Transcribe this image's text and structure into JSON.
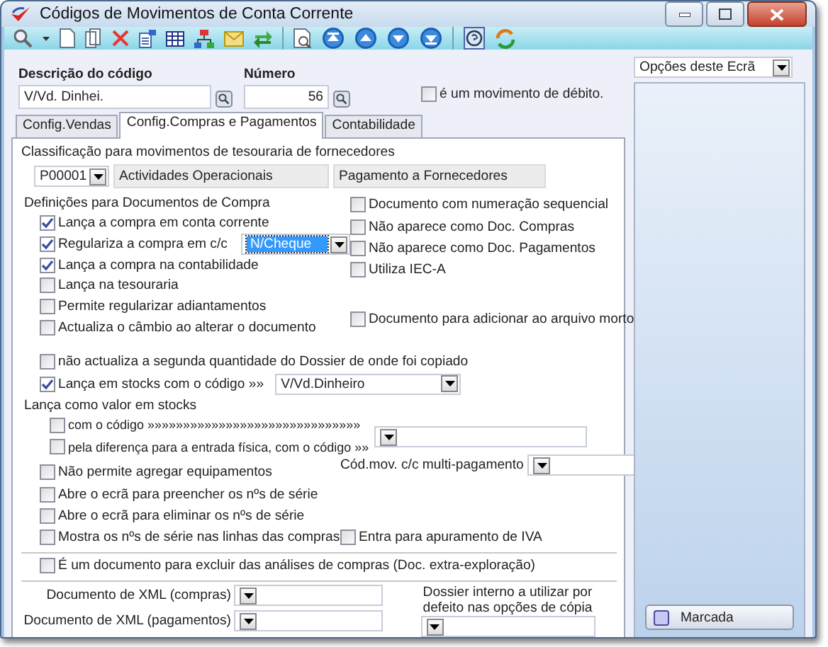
{
  "window": {
    "title": "Códigos de Movimentos de Conta Corrente"
  },
  "options_dropdown": {
    "value": "Opções deste Ecrã"
  },
  "description": {
    "label": "Descrição do código",
    "value": "V/Vd. Dinhei."
  },
  "number": {
    "label": "Número",
    "value": "56"
  },
  "debit": {
    "label": "é um movimento de débito.",
    "checked": false
  },
  "tabs": [
    {
      "label": "Config.Vendas",
      "selected": false
    },
    {
      "label": "Config.Compras e Pagamentos",
      "selected": true
    },
    {
      "label": "Contabilidade",
      "selected": false
    }
  ],
  "classification": {
    "label": "Classificação para movimentos de tesouraria de fornecedores",
    "code": "P00001",
    "category": "Actividades Operacionais",
    "description": "Pagamento a Fornecedores"
  },
  "purchase_definitions": {
    "title": "Definições para Documentos de Compra",
    "left": [
      {
        "kind": "checkbox",
        "label": "Lança a compra em conta corrente",
        "checked": true
      },
      {
        "kind": "checkbox_combo",
        "label": "Regulariza a compra em c/c",
        "checked": true,
        "value": "N/Cheque",
        "focused": true
      },
      {
        "kind": "checkbox",
        "label": "Lança a compra na contabilidade",
        "checked": true
      },
      {
        "kind": "checkbox",
        "label": "Lança na tesouraria",
        "checked": false
      },
      {
        "kind": "checkbox",
        "label": "Permite regularizar adiantamentos",
        "checked": false
      },
      {
        "kind": "checkbox",
        "label": "Actualiza o câmbio ao alterar o documento",
        "checked": false
      }
    ],
    "right": [
      {
        "label": "Documento com numeração sequencial",
        "checked": false
      },
      {
        "label": "Não aparece como Doc. Compras",
        "checked": false
      },
      {
        "label": "Não aparece como Doc. Pagamentos",
        "checked": false
      },
      {
        "label": "Utiliza IEC-A",
        "checked": false
      }
    ],
    "right_lower": [
      {
        "label": "Documento para adicionar ao arquivo morto",
        "checked": false
      }
    ]
  },
  "stocks": [
    {
      "kind": "checkbox",
      "label": "não actualiza a segunda quantidade do Dossier de onde foi copiado",
      "checked": false
    },
    {
      "kind": "checkbox_combo",
      "label": "Lança em stocks com o código »»",
      "checked": true,
      "value": "V/Vd.Dinheiro",
      "focused": false
    }
  ],
  "stock_value": {
    "title": "Lança como valor em stocks",
    "options": [
      {
        "label": "com o código »»»»»»»»»»»»»»»»»»»»»»»»»»»»»»",
        "checked": false
      },
      {
        "label": "pela diferença para a entrada física, com o código »»",
        "checked": false
      }
    ]
  },
  "equipment": [
    {
      "label": "Não permite agregar equipamentos",
      "checked": false
    },
    {
      "label": "Abre o ecrã para preencher os nºs de série",
      "checked": false
    },
    {
      "label": "Abre o ecrã para eliminar os nºs de série",
      "checked": false
    },
    {
      "label": "Mostra os nºs de série nas linhas das compras",
      "checked": false
    }
  ],
  "multi_payment": {
    "label": "Cód.mov. c/c multi-pagamento"
  },
  "vat": {
    "label": "Entra para apuramento de IVA",
    "checked": false
  },
  "exclude": {
    "label": "É um documento para excluir das análises de compras (Doc. extra-exploração)",
    "checked": false
  },
  "xml": [
    {
      "label": "Documento de XML (compras)"
    },
    {
      "label": "Documento de XML (pagamentos)"
    }
  ],
  "internal_dossier": {
    "label": "Dossier interno a utilizar por defeito nas opções de cópia"
  },
  "marked_button": {
    "label": "Marcada"
  }
}
